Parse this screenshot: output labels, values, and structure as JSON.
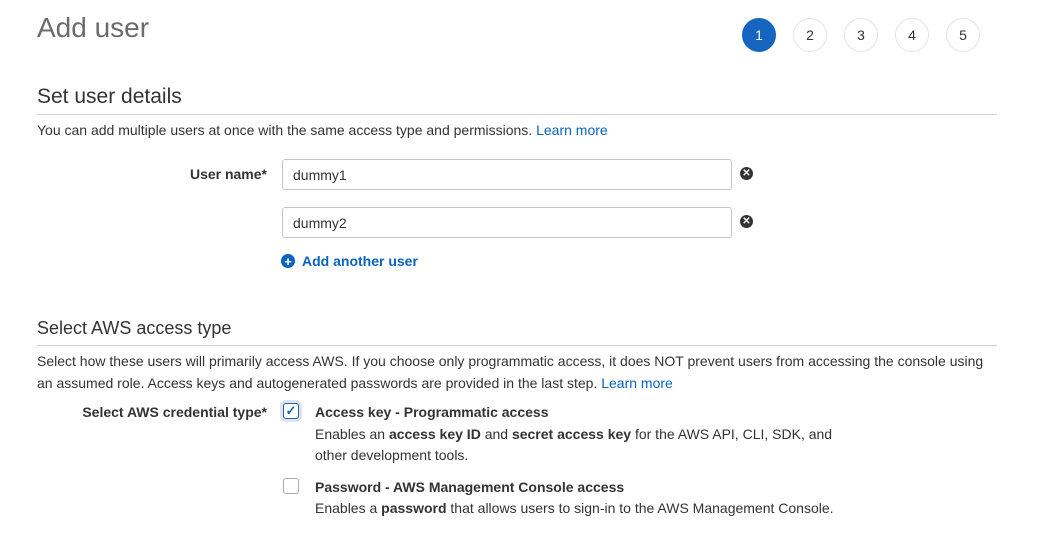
{
  "header": {
    "title": "Add user",
    "steps": [
      "1",
      "2",
      "3",
      "4",
      "5"
    ],
    "active_step": 1
  },
  "details": {
    "heading": "Set user details",
    "description": "You can add multiple users at once with the same access type and permissions.",
    "learn_more": "Learn more",
    "user_name_label": "User name*",
    "users": [
      "dummy1",
      "dummy2"
    ],
    "add_another": "Add another user"
  },
  "access": {
    "heading": "Select AWS access type",
    "description": "Select how these users will primarily access AWS. If you choose only programmatic access, it does NOT prevent users from accessing the console using an assumed role. Access keys and autogenerated passwords are provided in the last step.",
    "learn_more": "Learn more",
    "credential_label": "Select AWS credential type*",
    "options": [
      {
        "title": "Access key - Programmatic access",
        "checked": true,
        "desc": [
          "Enables an ",
          "access key ID",
          " and ",
          "secret access key",
          " for the AWS API, CLI, SDK, and other development tools."
        ]
      },
      {
        "title": "Password - AWS Management Console access",
        "checked": false,
        "desc": [
          "Enables a ",
          "password",
          " that allows users to sign-in to the AWS Management Console."
        ]
      }
    ]
  },
  "colors": {
    "accent": "#1665c0",
    "link": "#0a63bd"
  }
}
